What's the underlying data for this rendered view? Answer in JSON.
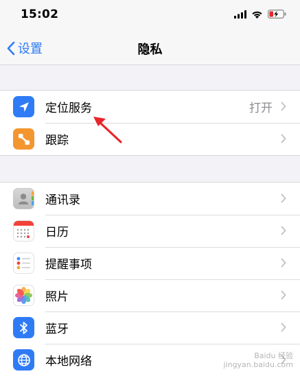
{
  "status_bar": {
    "time": "15:02"
  },
  "nav": {
    "back_label": "设置",
    "title": "隐私"
  },
  "group1": [
    {
      "label": "定位服务",
      "detail": "打开",
      "icon": "location-arrow-icon"
    },
    {
      "label": "跟踪",
      "icon": "tracking-icon"
    }
  ],
  "group2": [
    {
      "label": "通讯录",
      "icon": "contacts-icon"
    },
    {
      "label": "日历",
      "icon": "calendar-icon"
    },
    {
      "label": "提醒事项",
      "icon": "reminders-icon"
    },
    {
      "label": "照片",
      "icon": "photos-icon"
    },
    {
      "label": "蓝牙",
      "icon": "bluetooth-icon"
    },
    {
      "label": "本地网络",
      "icon": "globe-icon"
    }
  ],
  "watermark": {
    "line1": "Baidu 经验",
    "line2": "jingyan.baidu.com"
  },
  "colors": {
    "accent": "#2f7bf6",
    "annotation": "#e8262b"
  }
}
